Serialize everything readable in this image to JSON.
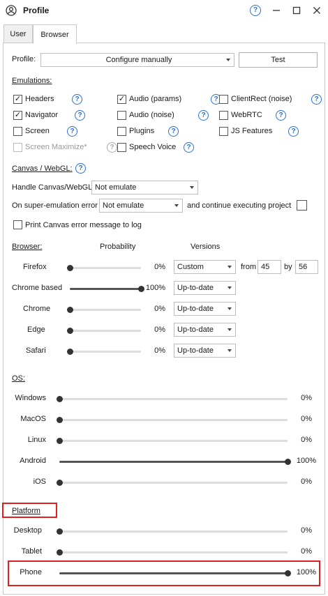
{
  "window": {
    "title": "Profile"
  },
  "tabs": [
    {
      "label": "User"
    },
    {
      "label": "Browser"
    }
  ],
  "profile": {
    "label": "Profile:",
    "value": "Configure manually",
    "test_label": "Test"
  },
  "emulations": {
    "title": "Emulations:",
    "items": [
      {
        "label": "Headers",
        "checked": true,
        "enabled": true
      },
      {
        "label": "Navigator",
        "checked": true,
        "enabled": true
      },
      {
        "label": "Screen",
        "checked": false,
        "enabled": true
      },
      {
        "label": "Screen Maximize*",
        "checked": false,
        "enabled": false
      },
      {
        "label": "Audio (params)",
        "checked": true,
        "enabled": true
      },
      {
        "label": "Audio (noise)",
        "checked": false,
        "enabled": true
      },
      {
        "label": "Plugins",
        "checked": false,
        "enabled": true
      },
      {
        "label": "Speech Voice",
        "checked": false,
        "enabled": true
      },
      {
        "label": "ClientRect (noise)",
        "checked": false,
        "enabled": true
      },
      {
        "label": "WebRTC",
        "checked": false,
        "enabled": true
      },
      {
        "label": "JS Features",
        "checked": false,
        "enabled": true
      }
    ]
  },
  "canvas": {
    "title": "Canvas / WebGL:",
    "handle_label": "Handle Canvas/WebGL",
    "handle_value": "Not emulate",
    "super_label": "On super-emulation error",
    "super_value": "Not emulate",
    "continue_label": "and continue executing project",
    "continue_checked": false,
    "print_label": "Print Canvas error message to log",
    "print_checked": false
  },
  "browser": {
    "title": "Browser:",
    "col_probability": "Probability",
    "col_versions": "Versions",
    "rows": [
      {
        "name": "Firefox",
        "level": 0,
        "pct": "0%",
        "version": "Custom",
        "from_label": "from",
        "from": "45",
        "by_label": "by",
        "by": "56"
      },
      {
        "name": "Chrome based",
        "level": 100,
        "pct": "100%",
        "version": "Up-to-date"
      },
      {
        "name": "Chrome",
        "level": 0,
        "pct": "0%",
        "version": "Up-to-date"
      },
      {
        "name": "Edge",
        "level": 0,
        "pct": "0%",
        "version": "Up-to-date"
      },
      {
        "name": "Safari",
        "level": 0,
        "pct": "0%",
        "version": "Up-to-date"
      }
    ]
  },
  "os": {
    "title": "OS:",
    "rows": [
      {
        "name": "Windows",
        "level": 0,
        "pct": "0%"
      },
      {
        "name": "MacOS",
        "level": 0,
        "pct": "0%"
      },
      {
        "name": "Linux",
        "level": 0,
        "pct": "0%"
      },
      {
        "name": "Android",
        "level": 100,
        "pct": "100%"
      },
      {
        "name": "iOS",
        "level": 0,
        "pct": "0%"
      }
    ]
  },
  "platform": {
    "title": "Platform",
    "rows": [
      {
        "name": "Desktop",
        "level": 0,
        "pct": "0%"
      },
      {
        "name": "Tablet",
        "level": 0,
        "pct": "0%"
      },
      {
        "name": "Phone",
        "level": 100,
        "pct": "100%"
      }
    ]
  },
  "colors": {
    "highlight": "#e02020",
    "help": "#2b6fd6"
  }
}
